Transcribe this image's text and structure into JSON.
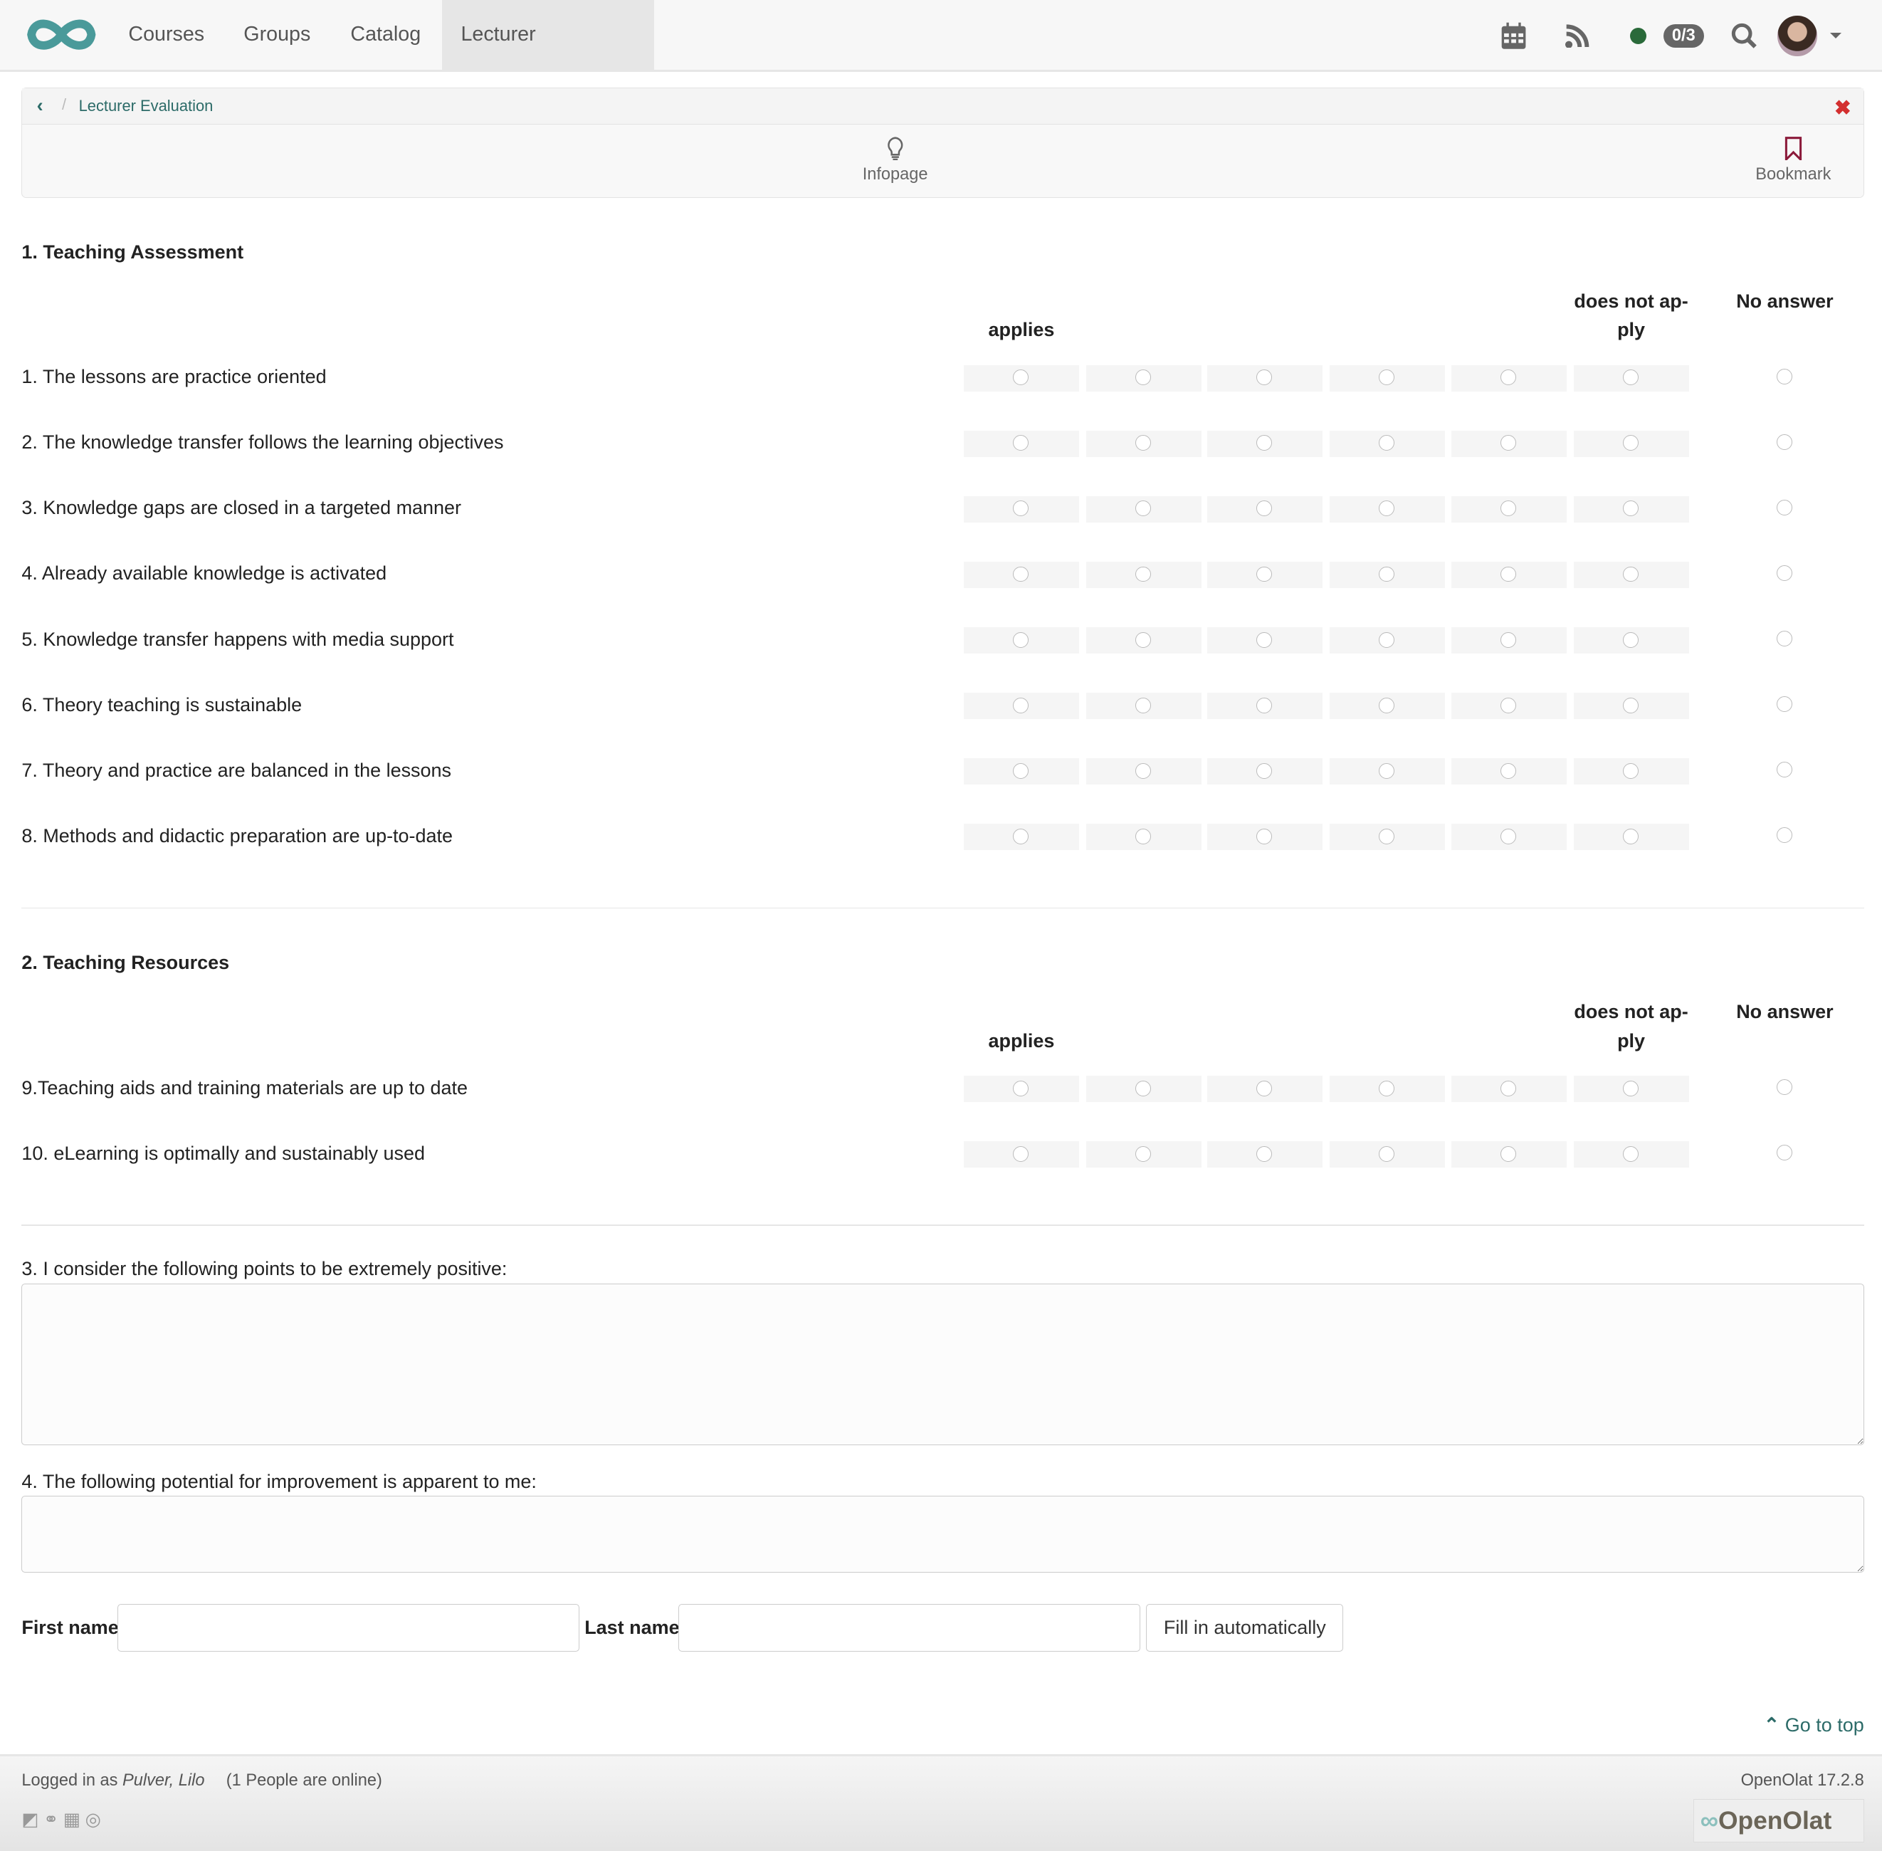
{
  "nav": {
    "items": [
      "Courses",
      "Groups",
      "Catalog"
    ],
    "active_tab": "Lecturer Evalua...",
    "badge": "0/3",
    "status_color": "#2a6a3a",
    "accent": "#4a9a9a"
  },
  "toolbar": {
    "breadcrumb": "Lecturer Evaluation",
    "infopage": "Infopage",
    "bookmark": "Bookmark"
  },
  "sections": [
    {
      "title": "1. Teaching Assessment",
      "col_applies": "applies",
      "col_not_apply": "does not ap-ply",
      "col_no_answer": "No answer",
      "questions": [
        "1. The lessons are practice oriented",
        "2. The knowledge transfer follows the learning objectives",
        "3. Knowledge gaps are closed in a targeted manner",
        "4. Already available knowledge is activated",
        "5. Knowledge transfer happens with media support",
        "6. Theory teaching is sustainable",
        "7. Theory and practice are balanced in the lessons",
        "8. Methods and didactic preparation are up-to-date"
      ]
    },
    {
      "title": "2. Teaching Resources",
      "col_applies": "applies",
      "col_not_apply": "does not ap-ply",
      "col_no_answer": "No answer",
      "questions": [
        "9.Teaching aids and training materials are up to date",
        "10. eLearning is optimally and sustainably used"
      ]
    }
  ],
  "text_questions": [
    "3. I consider the following points to be extremely positive:",
    "4. The following potential for improvement is apparent to me:"
  ],
  "name_form": {
    "first": "First name",
    "last": "Last name",
    "first_value": "",
    "last_value": "",
    "fill_button": "Fill in automatically"
  },
  "go_top": "Go to top",
  "footer": {
    "logged_in_prefix": "Logged in as ",
    "user": "Pulver, Lilo",
    "online": "(1 People are online)",
    "version": "OpenOlat 17.2.8",
    "brand": "OpenOlat"
  }
}
